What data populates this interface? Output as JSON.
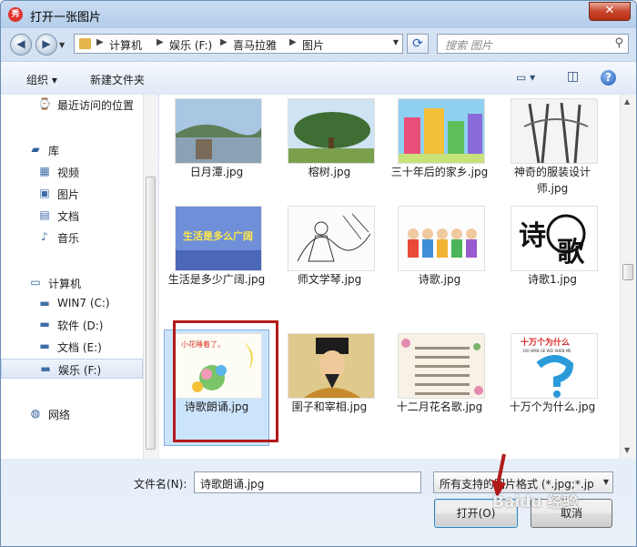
{
  "window": {
    "title": "打开一张图片",
    "close_glyph": "✕"
  },
  "nav": {
    "back_glyph": "◀",
    "forward_glyph": "▶",
    "breadcrumb": [
      "计算机",
      "娱乐 (F:)",
      "喜马拉雅",
      "图片"
    ],
    "search_placeholder": "搜索 图片"
  },
  "toolbar": {
    "organize": "组织",
    "new_folder": "新建文件夹",
    "help_glyph": "?"
  },
  "sidebar": {
    "items": [
      {
        "label": "最近访问的位置",
        "icon": "recent-places-icon",
        "glyph": "⌚",
        "indent": 1,
        "y": 0
      },
      {
        "label": "库",
        "icon": "library-icon",
        "glyph": "▰",
        "indent": 0,
        "y": 1
      },
      {
        "label": "视频",
        "icon": "video-icon",
        "glyph": "▦",
        "indent": 1,
        "y": 2
      },
      {
        "label": "图片",
        "icon": "pictures-icon",
        "glyph": "▣",
        "indent": 1,
        "y": 3
      },
      {
        "label": "文档",
        "icon": "documents-icon",
        "glyph": "▤",
        "indent": 1,
        "y": 4
      },
      {
        "label": "音乐",
        "icon": "music-icon",
        "glyph": "♪",
        "indent": 1,
        "y": 5
      },
      {
        "label": "计算机",
        "icon": "computer-icon",
        "glyph": "▭",
        "indent": 0,
        "y": 6
      },
      {
        "label": "WIN7 (C:)",
        "icon": "system-drive-icon",
        "glyph": "▬",
        "indent": 1,
        "y": 7
      },
      {
        "label": "软件 (D:)",
        "icon": "drive-icon",
        "glyph": "▬",
        "indent": 1,
        "y": 8
      },
      {
        "label": "文档 (E:)",
        "icon": "drive-icon",
        "glyph": "▬",
        "indent": 1,
        "y": 9
      },
      {
        "label": "娱乐 (F:)",
        "icon": "drive-icon",
        "glyph": "▬",
        "indent": 1,
        "y": 10,
        "selected": true
      },
      {
        "label": "网络",
        "icon": "network-icon",
        "glyph": "◍",
        "indent": 0,
        "y": 11
      }
    ]
  },
  "files": [
    {
      "name": "日月潭.jpg",
      "thumb": "lake-thumb"
    },
    {
      "name": "榕树.jpg",
      "thumb": "banyan-thumb"
    },
    {
      "name": "三十年后的家乡.jpg",
      "thumb": "hometown-thumb"
    },
    {
      "name": "神奇的服装设计师.jpg",
      "thumb": "fashion-thumb"
    },
    {
      "name": "生活是多少广阔.jpg",
      "thumb": "life-thumb",
      "thumb_text": "生活是多么广阔"
    },
    {
      "name": "师文学琴.jpg",
      "thumb": "guqin-thumb"
    },
    {
      "name": "诗歌.jpg",
      "thumb": "kids-thumb"
    },
    {
      "name": "诗歌1.jpg",
      "thumb": "calligraphy-thumb",
      "thumb_text": "诗歌"
    },
    {
      "name": "诗歌朗诵.jpg",
      "thumb": "recital-thumb",
      "thumb_text": "小花睡着了。",
      "selected": true
    },
    {
      "name": "圉子和宰相.jpg",
      "thumb": "minister-thumb"
    },
    {
      "name": "十二月花名歌.jpg",
      "thumb": "flowers-thumb"
    },
    {
      "name": "十万个为什么.jpg",
      "thumb": "whys-thumb",
      "thumb_text": "十万个为什么",
      "thumb_subtext": "100 WAN GE WEI SHEN ME"
    }
  ],
  "footer": {
    "filename_label": "文件名(N):",
    "filename_value": "诗歌朗诵.jpg",
    "filter": "所有支持的图片格式 (*.jpg;*.jp",
    "open_button": "打开(O)",
    "cancel_button": "取消"
  },
  "watermark": "Baidu 经验",
  "colors": {
    "selection": "#cce4fb",
    "annotation_red": "#b21a1a",
    "accent_blue": "#3c7fb1"
  }
}
